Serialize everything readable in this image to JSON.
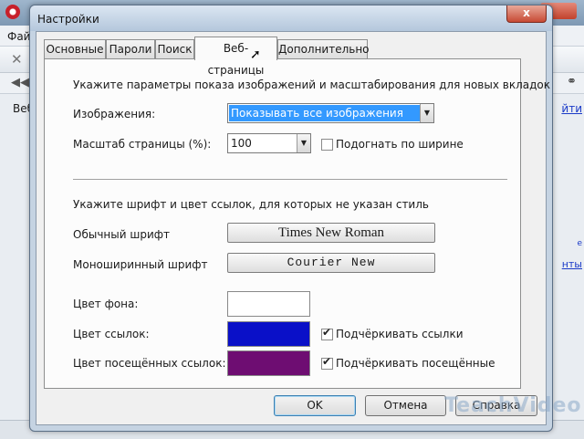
{
  "background_app": {
    "menu_text": "Фай",
    "tab_text": "Веб",
    "link_top": "йти",
    "link_mid": "е",
    "link_low": "нты"
  },
  "dialog": {
    "title": "Настройки",
    "close_symbol": "x",
    "tabs": [
      {
        "label": "Основные",
        "active": false
      },
      {
        "label": "Пароли",
        "active": false
      },
      {
        "label": "Поиск",
        "active": false
      },
      {
        "label": "Веб-страницы",
        "active": true
      },
      {
        "label": "Дополнительно",
        "active": false
      }
    ],
    "images_section": {
      "heading": "Укажите параметры показа изображений и масштабирования для новых вкладок",
      "images_label": "Изображения:",
      "images_value": "Показывать все изображения",
      "zoom_label": "Масштаб страницы (%):",
      "zoom_value": "100",
      "fit_width_label": "Подогнать по ширине",
      "fit_width_checked": false
    },
    "fonts_section": {
      "heading": "Укажите шрифт и цвет ссылок, для которых не указан стиль",
      "normal_font_label": "Обычный шрифт",
      "normal_font_value": "Times New Roman",
      "mono_font_label": "Моноширинный шрифт",
      "mono_font_value": "Courier New",
      "bg_color_label": "Цвет фона:",
      "bg_color": "#ffffff",
      "link_color_label": "Цвет ссылок:",
      "link_color": "#0a10c8",
      "underline_links_label": "Подчёркивать ссылки",
      "underline_links_checked": true,
      "visited_color_label": "Цвет посещённых ссылок:",
      "visited_color": "#6e0d72",
      "underline_visited_label": "Подчёркивать посещённые",
      "underline_visited_checked": true
    },
    "buttons": {
      "ok": "OK",
      "cancel": "Отмена",
      "help": "Справка"
    }
  },
  "watermark": "TeachVideo"
}
